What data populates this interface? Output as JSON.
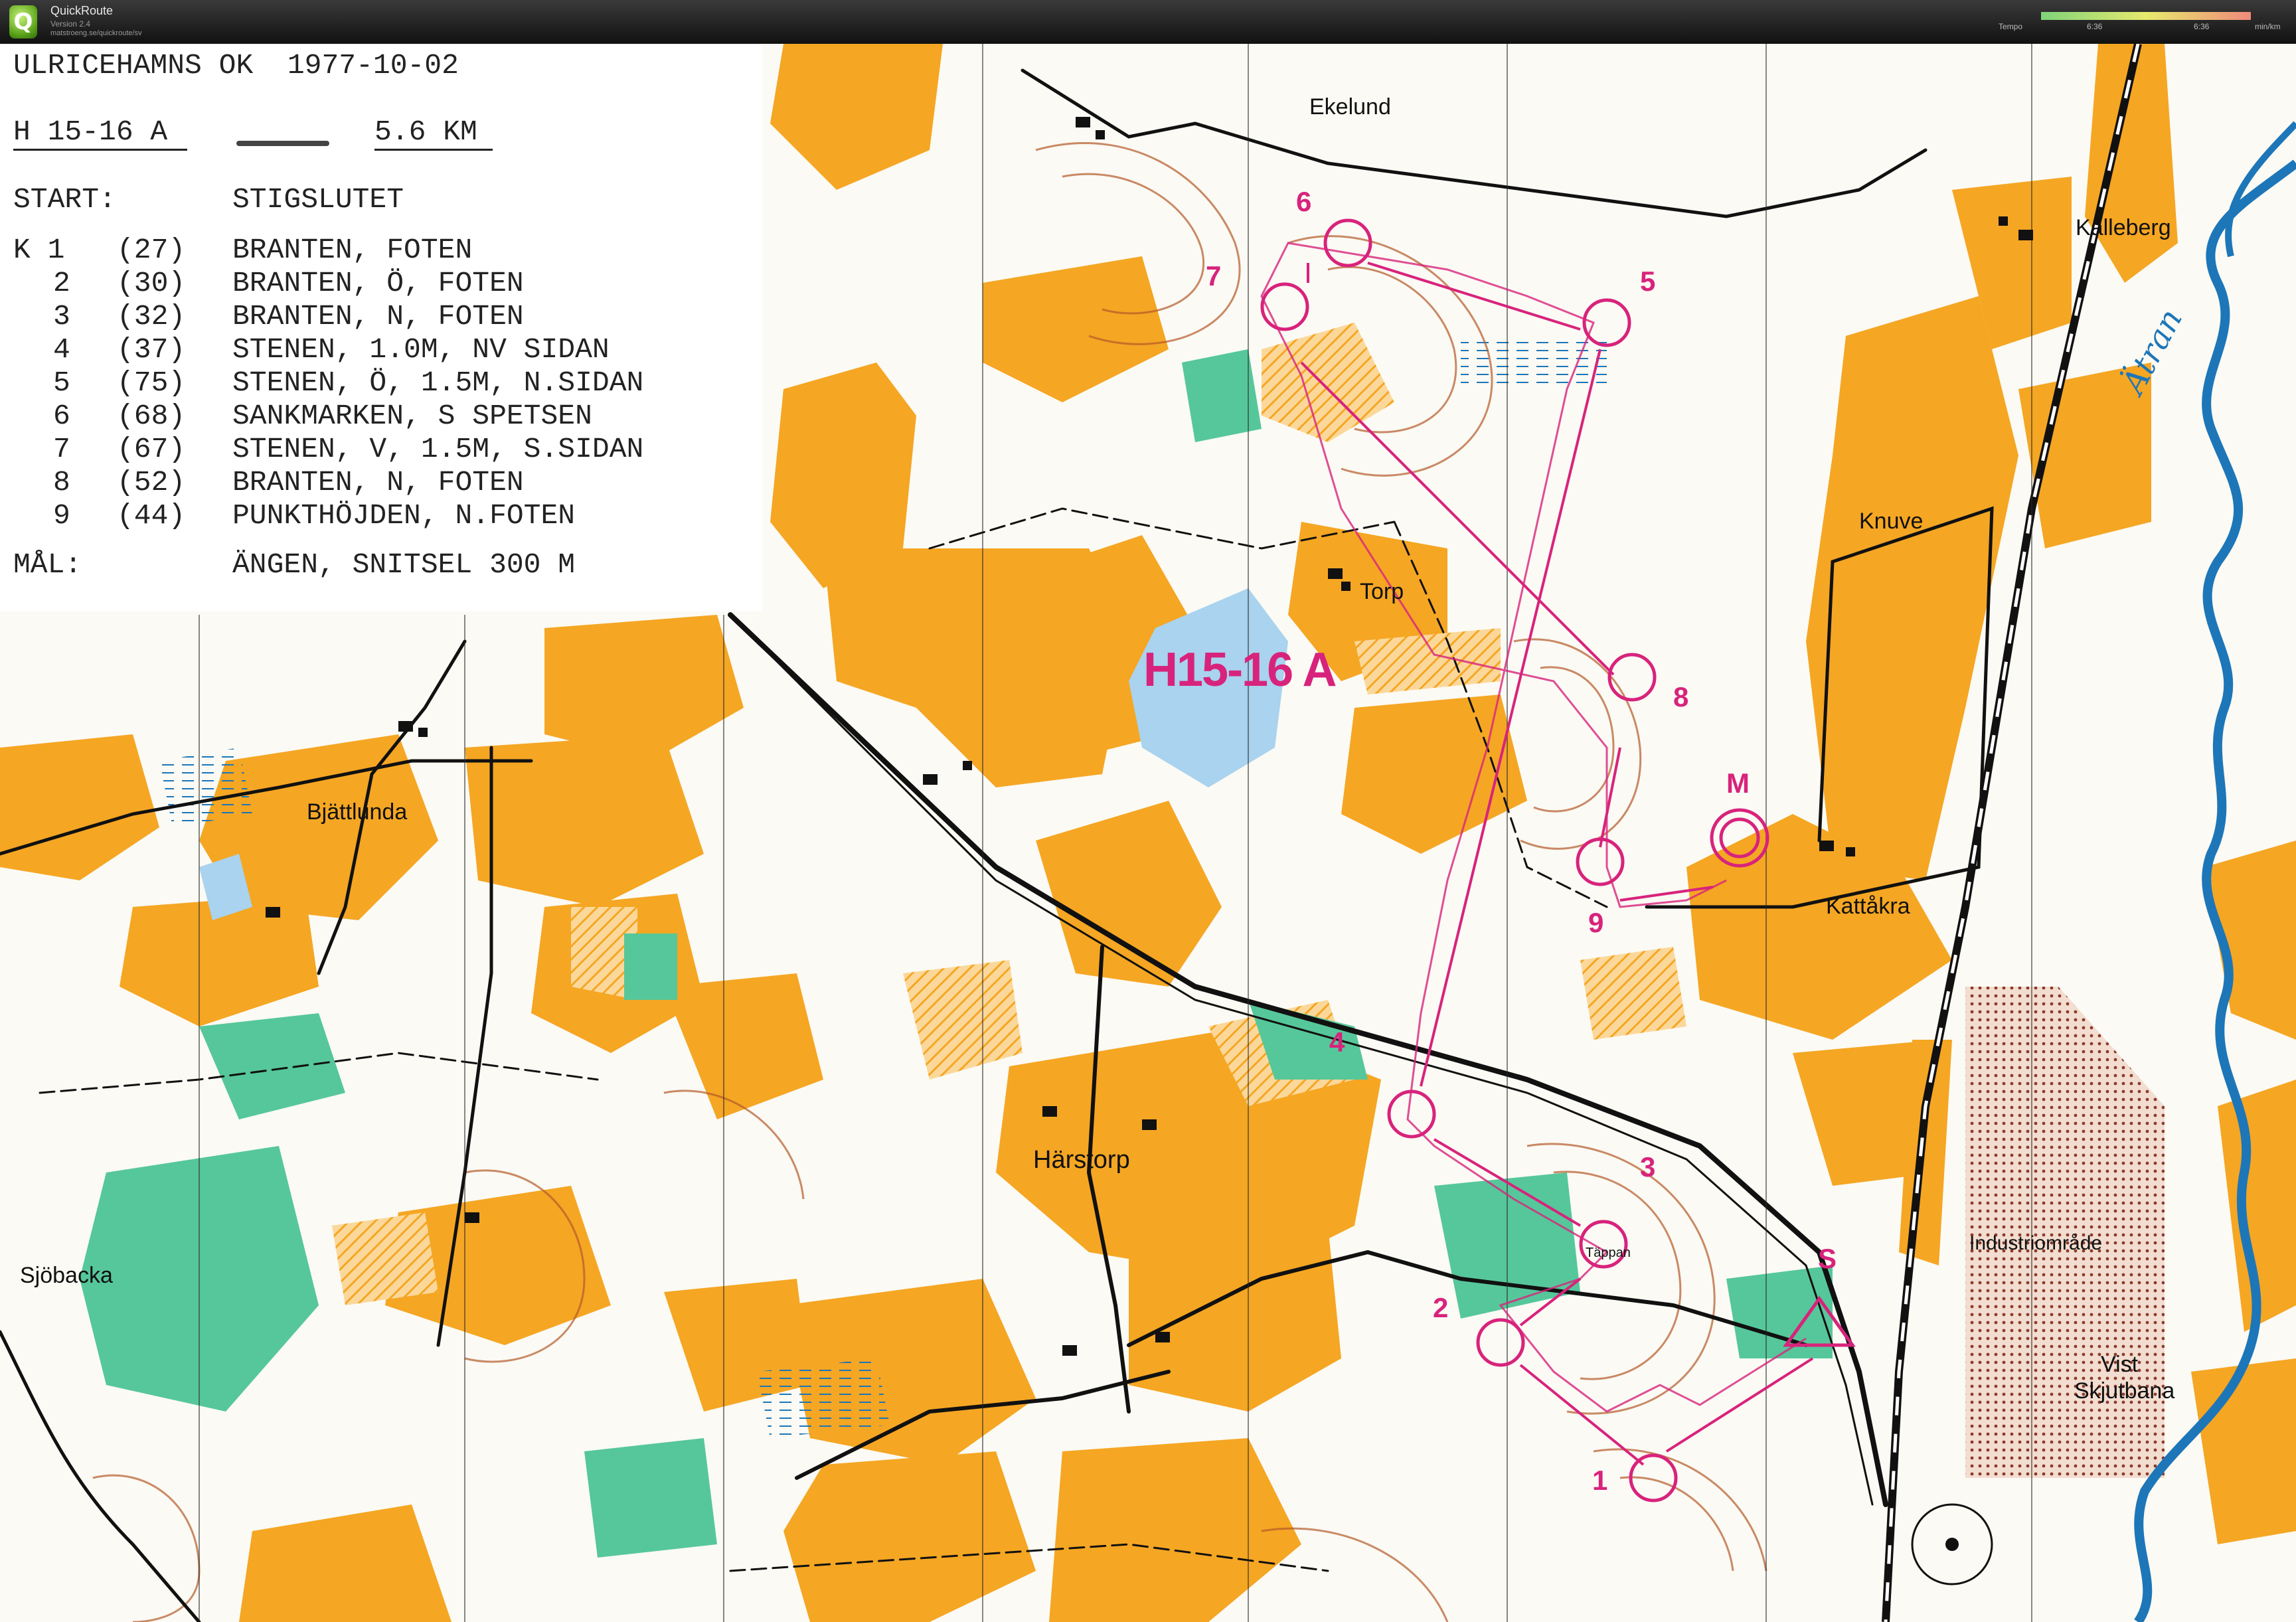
{
  "window": {
    "app_name": "QuickRoute",
    "version": "Version 2.4",
    "url": "matstroeng.se/quickroute/sv",
    "tempo_label": "Tempo",
    "tempo_min": "6:36",
    "tempo_max": "6:36",
    "tempo_unit": "min/km"
  },
  "legend": {
    "club_date": "ULRICEHAMNS OK  1977-10-02",
    "class_label": "H 15-16 A",
    "distance": "5.6 KM",
    "start_label": "START:",
    "start_desc": "STIGSLUTET",
    "controls": [
      {
        "k": "K 1",
        "code": "(27)",
        "desc": "BRANTEN, FOTEN"
      },
      {
        "k": "2",
        "code": "(30)",
        "desc": "BRANTEN, Ö, FOTEN"
      },
      {
        "k": "3",
        "code": "(32)",
        "desc": "BRANTEN, N, FOTEN"
      },
      {
        "k": "4",
        "code": "(37)",
        "desc": "STENEN, 1.0M, NV SIDAN"
      },
      {
        "k": "5",
        "code": "(75)",
        "desc": "STENEN, Ö, 1.5M, N.SIDAN"
      },
      {
        "k": "6",
        "code": "(68)",
        "desc": "SANKMARKEN, S SPETSEN"
      },
      {
        "k": "7",
        "code": "(67)",
        "desc": "STENEN, V, 1.5M, S.SIDAN"
      },
      {
        "k": "8",
        "code": "(52)",
        "desc": "BRANTEN, N, FOTEN"
      },
      {
        "k": "9",
        "code": "(44)",
        "desc": "PUNKTHÖJDEN, N.FOTEN"
      }
    ],
    "finish_label": "MÅL:",
    "finish_desc": "ÄNGEN, SNITSEL 300 M"
  },
  "map": {
    "course_title": "H15-16 A",
    "river_label": "Ätran",
    "places": {
      "ekelund": "Ekelund",
      "kalleberg": "Källeberg",
      "knuve": "Knuve",
      "torp": "Torp",
      "bjattlunda": "Bjättlunda",
      "kattakra": "Kattåkra",
      "harstorp": "Härstorp",
      "sjobacka": "Sjöbacka",
      "industriomrade": "Industriområde",
      "vist": "Vist",
      "skjutbana": "Skjutbana",
      "tappan": "Täppan"
    },
    "control_numbers": {
      "c1": "1",
      "c2": "2",
      "c3": "3",
      "c4": "4",
      "c5": "5",
      "c6": "6",
      "c7": "7",
      "c8": "8",
      "c9": "9"
    },
    "start_symbol": "S",
    "finish_symbol": "M",
    "colors": {
      "open_land": "#f5a623",
      "forest": "#ffffff",
      "green": "#56c79a",
      "water": "#1d76b8",
      "lake": "#a9d3ee",
      "course": "#d8237c",
      "contour": "#b45a2a",
      "road": "#111111"
    }
  }
}
